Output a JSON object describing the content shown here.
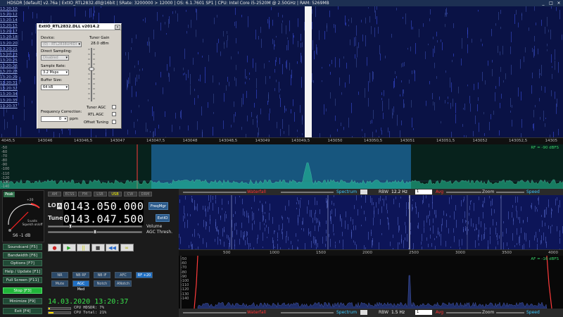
{
  "window": {
    "title": "HDSDR [default] v2.76a | ExtIO_RTL2832.dll@16bit | SRate: 3200000 > 12000 | OS: 6.1.7601 SP1 | CPU: Intel Core i5-2520M @ 2.50GHz | RAM: 5269MB",
    "controls": [
      "_",
      "□",
      "×"
    ]
  },
  "waterfall": {
    "timestamps": [
      "13:20:10",
      "13:20:12",
      "13:20:14",
      "13:20:15",
      "13:20:17",
      "13:20:18",
      "13:20:20",
      "13:20:21",
      "13:20:23",
      "13:20:25",
      "13:20:26",
      "13:20:28",
      "13:20:29",
      "13:20:31",
      "13:20:32",
      "13:20:34",
      "13:20:35",
      "13:20:37"
    ],
    "freq_ticks": [
      "4045,5",
      "143046",
      "143046,5",
      "143047",
      "143047,5",
      "143048",
      "143048,5",
      "143049",
      "143049,5",
      "143050",
      "143050,5",
      "143051",
      "143051,5",
      "143052",
      "143052,5",
      "14305"
    ],
    "rf_info": "RF = -90 dBFS",
    "db_scale": [
      "-50",
      "-60",
      "-70",
      "-80",
      "-90",
      "-100",
      "-110",
      "-120",
      "-130",
      "-140"
    ]
  },
  "dialog": {
    "title": "ExtIO_RTL2832.DLL v2014.2",
    "close": "×",
    "device_label": "Device:",
    "device_value": "(0) - RTL2838UHIDI",
    "direct_sampling_label": "Direct Sampling:",
    "direct_sampling_value": "Disabled",
    "sample_rate_label": "Sample Rate:",
    "sample_rate_value": "3.2 Msps",
    "buffer_size_label": "Buffer Size:",
    "buffer_size_value": "64 kB",
    "freq_correction_label": "Frequency Correction:",
    "freq_correction_value": "0",
    "freq_correction_unit": "ppm",
    "tuner_gain_label": "Tuner Gain",
    "tuner_gain_value": "28.0 dBm",
    "tuner_agc_label": "Tuner AGC",
    "rtl_agc_label": "RTL AGC",
    "offset_tuning_label": "Offset Tuning"
  },
  "smeter": {
    "peak_label": "Peak",
    "scale_top": "+20",
    "caption": "S-units\nSquelch on/off",
    "reading": "S6 -1 dB"
  },
  "side_buttons": [
    {
      "label": "Soundcard  [F5]"
    },
    {
      "label": "Bandwidth  [F6]"
    },
    {
      "label": "Options  [F7]"
    },
    {
      "label": "Help / Update  [F1]"
    },
    {
      "label": "Full Screen  [F11]"
    },
    {
      "label": "Stop  [F3]",
      "active": true
    },
    {
      "label": "Minimize  [F9]"
    },
    {
      "label": "Exit  [F4]"
    }
  ],
  "modes": [
    {
      "label": "AM"
    },
    {
      "label": "ECSS"
    },
    {
      "label": "FM"
    },
    {
      "label": "LSB"
    },
    {
      "label": "USB",
      "active": true
    },
    {
      "label": "CW"
    },
    {
      "label": "DRM"
    }
  ],
  "tuning": {
    "lo_label": "LO",
    "lo_badge": "A",
    "lo_value": "0143.050.000",
    "tune_label": "Tune",
    "tune_value": "0143.047.500",
    "freqmgr_label": "FreqMgr",
    "extio_label": "ExtIO",
    "volume_label": "Volume",
    "agc_label": "AGC Thresh."
  },
  "transport": [
    "●",
    "▶",
    "||",
    "■",
    "◀◀",
    "∞"
  ],
  "dsp": [
    {
      "label": "NR"
    },
    {
      "label": "NB RF"
    },
    {
      "label": "NB IF"
    },
    {
      "label": "AFC"
    },
    {
      "label": "RF +20",
      "on": true
    },
    {
      "label": "Mute"
    },
    {
      "label": "AGC Med",
      "on": true
    },
    {
      "label": "Notch"
    },
    {
      "label": "ANotch"
    }
  ],
  "datetime": "14.03.2020 13:20:37",
  "cpu": {
    "hdsdr": "CPU HDSDR:  7%",
    "total": "CPU Total: 21%"
  },
  "audio_toolbar": {
    "waterfall": "Waterfall",
    "spectrum": "Spectrum",
    "rbw_label": "RBW",
    "rbw_value": "12.2 Hz",
    "avg": "Avg",
    "zoom": "Zoom",
    "speed": "Speed",
    "avg_value": "1"
  },
  "audio_toolbar2": {
    "waterfall": "Waterfall",
    "spectrum": "Spectrum",
    "rbw_label": "RBW",
    "rbw_value": "1.5 Hz",
    "avg": "Avg",
    "zoom": "Zoom",
    "speed": "Speed",
    "avg_value": "1"
  },
  "audio_axis": [
    "500",
    "1000",
    "1500",
    "2000",
    "2500",
    "3000",
    "3500",
    "4000"
  ],
  "audio_info": "AF = -16 dBFS",
  "audio_db": [
    "-50",
    "-60",
    "-70",
    "-80",
    "-90",
    "-100",
    "-110",
    "-120",
    "-130",
    "-140"
  ],
  "colors": {
    "accent": "#1f6fc3",
    "wf_bg": "#0a1245",
    "green": "#39e04b",
    "red_marker": "#ff3b3b"
  }
}
